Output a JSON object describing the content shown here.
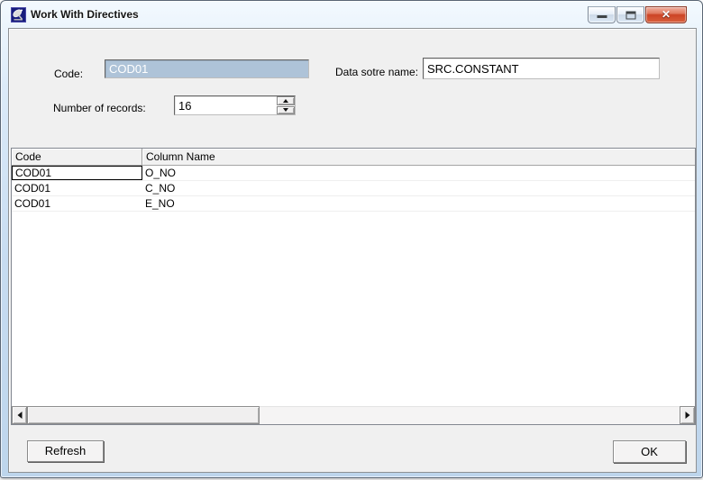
{
  "window": {
    "title": "Work With Directives",
    "app_icon": "satellite-dish-icon",
    "controls": [
      {
        "name": "minimize",
        "icon": "minimize-icon"
      },
      {
        "name": "maximize",
        "icon": "maximize-icon"
      },
      {
        "name": "close",
        "icon": "close-icon",
        "glyph": "✕"
      }
    ]
  },
  "form": {
    "code_label": "Code:",
    "code_value": "COD01",
    "code_disabled": true,
    "data_store_label": "Data sotre name:",
    "data_store_value": "SRC.CONSTANT",
    "records_label": "Number of records:",
    "records_value": "16"
  },
  "table": {
    "columns": [
      "Code",
      "Column Name"
    ],
    "rows": [
      [
        "COD01",
        "O_NO"
      ],
      [
        "COD01",
        "C_NO"
      ],
      [
        "COD01",
        "E_NO"
      ]
    ],
    "focused_cell": {
      "row": 0,
      "col": 0
    }
  },
  "scrollbar": {
    "orientation": "horizontal",
    "thumb_position": "left",
    "thumb_fraction": 0.35
  },
  "buttons": {
    "refresh": "Refresh",
    "ok": "OK"
  },
  "colors": {
    "titlebar_glass": "#c7dcf1",
    "close_button_red": "#cc4426",
    "client_bg": "#f0f0f0",
    "disabled_field_bg": "#aec3d8",
    "disabled_field_text": "#ffffff",
    "focus_border": "#000000",
    "header_bg": "#f1f1f1"
  }
}
